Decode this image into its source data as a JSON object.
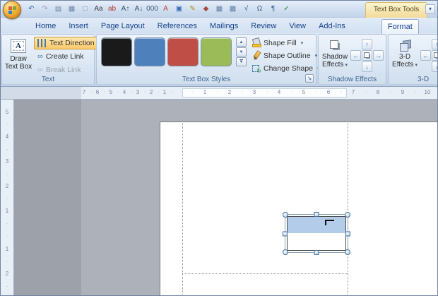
{
  "colors": {
    "contextual_accent": "#e8c15c",
    "tab_text": "#15428b",
    "highlight_orange": "#fbc968",
    "text_selection_blue": "#b3cce9",
    "page_white": "#ffffff",
    "pasteboard_gray": "#adb2ba"
  },
  "glyphs": {
    "dropdown": "▾",
    "dialog_launcher": "↘",
    "scroll_up": "▲",
    "scroll_down": "▼",
    "scroll_more": "▼",
    "titlebar_chevron": "▾",
    "nudge_up": "↑",
    "nudge_down": "↓",
    "nudge_left": "←",
    "nudge_right": "→",
    "draw_box_letter": "A",
    "create_link": "∞",
    "break_link": "∞",
    "change_shape_arrow": "↻"
  },
  "title_bar": {
    "contextual_group_label": "Text Box Tools",
    "qat_icons": [
      {
        "name": "undo-icon",
        "glyph": "↶",
        "color": "#2d5cae"
      },
      {
        "name": "redo-icon",
        "glyph": "↷",
        "color": "#8da0ba"
      },
      {
        "name": "print-preview-icon",
        "glyph": "▤",
        "color": "#6e83a0"
      },
      {
        "name": "quick-print-icon",
        "glyph": "▦",
        "color": "#6e83a0"
      },
      {
        "name": "new-document-icon",
        "glyph": "□",
        "color": "#6e83a0"
      },
      {
        "name": "change-case-icon",
        "glyph": "Aa",
        "color": "#3b3b3b"
      },
      {
        "name": "spelling-icon",
        "glyph": "ab",
        "color": "#b0392e"
      },
      {
        "name": "grow-font-icon",
        "glyph": "A↑",
        "color": "#33496b"
      },
      {
        "name": "shrink-font-icon",
        "glyph": "A↓",
        "color": "#33496b"
      },
      {
        "name": "word-count-icon",
        "glyph": "000",
        "color": "#445b7c"
      },
      {
        "name": "font-color-icon",
        "glyph": "A",
        "color": "#c23b2e"
      },
      {
        "name": "picture-icon",
        "glyph": "▣",
        "color": "#3f72b5"
      },
      {
        "name": "pencil-icon",
        "glyph": "✎",
        "color": "#b8860b"
      },
      {
        "name": "shapes-icon",
        "glyph": "◆",
        "color": "#a34c42"
      },
      {
        "name": "table-icon",
        "glyph": "▦",
        "color": "#5f7da3"
      },
      {
        "name": "borders-icon",
        "glyph": "▩",
        "color": "#5f7da3"
      },
      {
        "name": "equation-icon",
        "glyph": "√",
        "color": "#365a8c"
      },
      {
        "name": "symbol-icon",
        "glyph": "Ω",
        "color": "#365a8c"
      },
      {
        "name": "paragraph-mark-icon",
        "glyph": "¶",
        "color": "#365a8c"
      },
      {
        "name": "autocorrect-icon",
        "glyph": "✓",
        "color": "#2e7d32"
      }
    ]
  },
  "tabs": [
    {
      "label": "Home"
    },
    {
      "label": "Insert"
    },
    {
      "label": "Page Layout"
    },
    {
      "label": "References"
    },
    {
      "label": "Mailings"
    },
    {
      "label": "Review"
    },
    {
      "label": "View"
    },
    {
      "label": "Add-Ins"
    },
    {
      "label": "Format",
      "active": true,
      "contextual": true
    }
  ],
  "ribbon": {
    "text_group": {
      "label": "Text",
      "draw_line1": "Draw",
      "draw_line2": "Text Box",
      "text_direction": "Text Direction",
      "create_link": "Create Link",
      "break_link": "Break Link"
    },
    "styles_group": {
      "label": "Text Box Styles",
      "swatches": [
        {
          "name": "black",
          "color": "#1a1a1a"
        },
        {
          "name": "blue",
          "color": "#4e81bc"
        },
        {
          "name": "red",
          "color": "#bf4e47"
        },
        {
          "name": "green",
          "color": "#9bba58"
        }
      ],
      "shape_fill": "Shape Fill",
      "shape_outline": "Shape Outline",
      "change_shape": "Change Shape"
    },
    "shadow_group": {
      "label": "Shadow Effects",
      "line1": "Shadow",
      "line2": "Effects"
    },
    "threed_group": {
      "label": "3-D",
      "line1": "3-D",
      "line2": "Effects"
    }
  },
  "ruler": {
    "horizontal": [
      {
        "t": "7",
        "p": 118
      },
      {
        "t": "·",
        "p": 128
      },
      {
        "t": "6",
        "p": 137
      },
      {
        "t": "·",
        "p": 147
      },
      {
        "t": "5",
        "p": 156
      },
      {
        "t": "·",
        "p": 166
      },
      {
        "t": "4",
        "p": 175
      },
      {
        "t": "·",
        "p": 185
      },
      {
        "t": "3",
        "p": 194
      },
      {
        "t": "·",
        "p": 204
      },
      {
        "t": "2",
        "p": 213
      },
      {
        "t": "·",
        "p": 223
      },
      {
        "t": "1",
        "p": 232
      },
      {
        "t": "·",
        "p": 242
      },
      {
        "t": "·",
        "p": 272
      },
      {
        "t": "1",
        "p": 289
      },
      {
        "t": "·",
        "p": 307
      },
      {
        "t": "2",
        "p": 324
      },
      {
        "t": "·",
        "p": 342
      },
      {
        "t": "3",
        "p": 359
      },
      {
        "t": "·",
        "p": 377
      },
      {
        "t": "4",
        "p": 394
      },
      {
        "t": "·",
        "p": 412
      },
      {
        "t": "5",
        "p": 429
      },
      {
        "t": "·",
        "p": 447
      },
      {
        "t": "6",
        "p": 464
      },
      {
        "t": "·",
        "p": 482
      },
      {
        "t": "7",
        "p": 499
      },
      {
        "t": "·",
        "p": 517
      },
      {
        "t": "8",
        "p": 534
      },
      {
        "t": "·",
        "p": 552
      },
      {
        "t": "9",
        "p": 569
      },
      {
        "t": "·",
        "p": 587
      },
      {
        "t": "10",
        "p": 604
      }
    ],
    "vertical": [
      {
        "t": "5",
        "p": 18
      },
      {
        "t": "·",
        "p": 36
      },
      {
        "t": "4",
        "p": 53
      },
      {
        "t": "·",
        "p": 71
      },
      {
        "t": "3",
        "p": 88
      },
      {
        "t": "·",
        "p": 106
      },
      {
        "t": "2",
        "p": 123
      },
      {
        "t": "·",
        "p": 141
      },
      {
        "t": "1",
        "p": 158
      },
      {
        "t": "·",
        "p": 176
      },
      {
        "t": "·",
        "p": 194
      },
      {
        "t": "1",
        "p": 212
      },
      {
        "t": "·",
        "p": 230
      },
      {
        "t": "2",
        "p": 247
      },
      {
        "t": "·",
        "p": 265
      }
    ]
  }
}
